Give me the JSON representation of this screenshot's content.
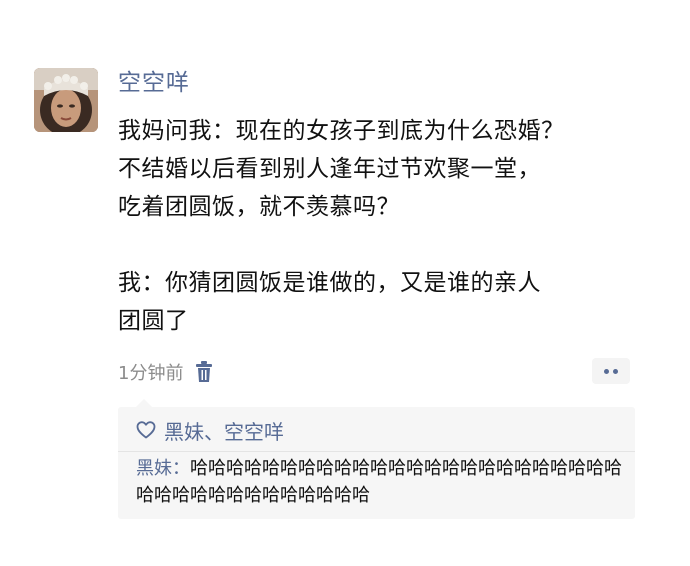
{
  "post": {
    "username": "空空咩",
    "paragraph1": "我妈问我：现在的女孩子到底为什么恐婚？\n不结婚以后看到别人逢年过节欢聚一堂，\n吃着团圆饭，就不羡慕吗？",
    "paragraph2": "我：你猜团圆饭是谁做的，又是谁的亲人\n团圆了",
    "time": "1分钟前"
  },
  "icons": {
    "avatar": "avatar",
    "delete": "trash-icon",
    "more": "more-dots-icon",
    "like": "heart-icon"
  },
  "likes": {
    "names": "黑妹、空空咩"
  },
  "comments": [
    {
      "author": "黑妹",
      "separator": "：",
      "text": "哈哈哈哈哈哈哈哈哈哈哈哈哈哈哈哈哈哈哈哈哈哈哈哈哈哈哈哈哈哈哈哈哈哈哈哈哈"
    }
  ],
  "colors": {
    "link": "#576b95",
    "text": "#111111",
    "meta": "#8c8c8c",
    "panel": "#f6f6f6"
  }
}
